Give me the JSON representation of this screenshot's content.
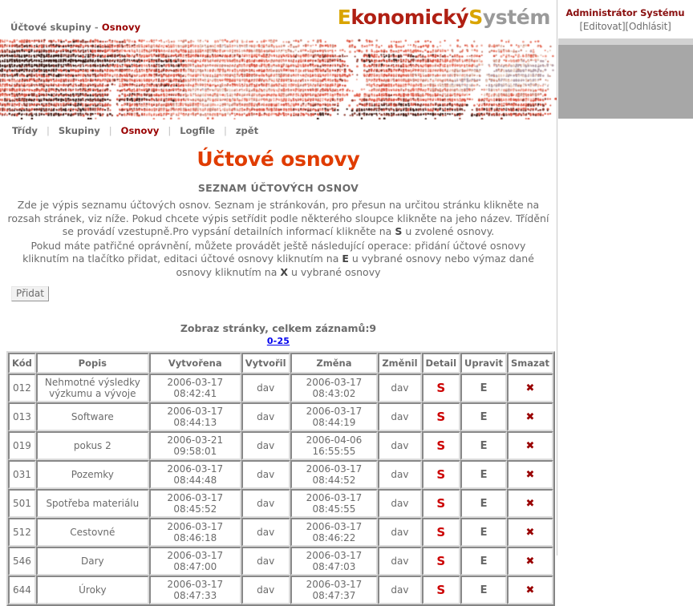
{
  "breadcrumb": {
    "parent": "Účtové skupiny",
    "separator": "-",
    "current": "Osnovy"
  },
  "logo": {
    "part1": "E",
    "part2": "konomický",
    "part3": "S",
    "part4": "ystém",
    "color_gold": "#d9a400",
    "color_red": "#b01f13",
    "color_gray": "#9a9a9a"
  },
  "admin": {
    "title": "Administrátor Systému",
    "edit_label": "[Editovat]",
    "logout_label": "[Odhlásit]"
  },
  "nav": {
    "items": [
      {
        "label": "Třídy",
        "active": false
      },
      {
        "label": "Skupiny",
        "active": false
      },
      {
        "label": "Osnovy",
        "active": true
      },
      {
        "label": "Logfile",
        "active": false
      },
      {
        "label": "zpět",
        "active": false
      }
    ],
    "separator": "|"
  },
  "page": {
    "title": "Účtové osnovy",
    "subtitle": "SEZNAM ÚČTOVÝCH OSNOV",
    "desc_line1": "Zde je výpis seznamu účtových osnov. Seznam je stránkován, pro přesun na určitou stránku klikněte na rozsah stránek, viz níže. Pokud chcete výpis setřídit podle některého sloupce klikněte na jeho název. Třídění se provádí vzestupně.Pro vypsání detailních informací klikněte na ",
    "desc_line1_bold": "S",
    "desc_line1_tail": " u zvolené osnovy.",
    "desc_line2_a": "Pokud máte patřičné oprávnění, můžete provádět ještě následující operace: přidání účtové osnovy kliknutím na tlačítko přidat, editaci účtové osnovy kliknutím na ",
    "desc_line2_bold1": "E",
    "desc_line2_b": " u vybrané osnovy nebo výmaz dané osnovy kliknutím na ",
    "desc_line2_bold2": "X",
    "desc_line2_c": " u vybrané osnovy",
    "add_button": "Přidat",
    "pager_label": "Zobraz stránky, celkem záznamů:9",
    "pager_range": "0-25"
  },
  "table": {
    "headers": [
      "Kód",
      "Popis",
      "Vytvořena",
      "Vytvořil",
      "Změna",
      "Změnil",
      "Detail",
      "Upravit",
      "Smazat"
    ],
    "action_detail": "S",
    "action_edit": "E",
    "action_delete": "✖",
    "rows": [
      {
        "kod": "012",
        "popis": "Nehmotné výsledky výzkumu a vývoje",
        "vytvorena": "2006-03-17\n08:42:41",
        "vytvoril": "dav",
        "zmena": "2006-03-17\n08:43:02",
        "zmenil": "dav"
      },
      {
        "kod": "013",
        "popis": "Software",
        "vytvorena": "2006-03-17\n08:44:13",
        "vytvoril": "dav",
        "zmena": "2006-03-17\n08:44:19",
        "zmenil": "dav"
      },
      {
        "kod": "019",
        "popis": "pokus 2",
        "vytvorena": "2006-03-21\n09:58:01",
        "vytvoril": "dav",
        "zmena": "2006-04-06\n16:55:55",
        "zmenil": "dav"
      },
      {
        "kod": "031",
        "popis": "Pozemky",
        "vytvorena": "2006-03-17\n08:44:48",
        "vytvoril": "dav",
        "zmena": "2006-03-17\n08:44:52",
        "zmenil": "dav"
      },
      {
        "kod": "501",
        "popis": "Spotřeba materiálu",
        "vytvorena": "2006-03-17\n08:45:52",
        "vytvoril": "dav",
        "zmena": "2006-03-17\n08:45:55",
        "zmenil": "dav"
      },
      {
        "kod": "512",
        "popis": "Cestovné",
        "vytvorena": "2006-03-17\n08:46:18",
        "vytvoril": "dav",
        "zmena": "2006-03-17\n08:46:22",
        "zmenil": "dav"
      },
      {
        "kod": "546",
        "popis": "Dary",
        "vytvorena": "2006-03-17\n08:47:00",
        "vytvoril": "dav",
        "zmena": "2006-03-17\n08:47:03",
        "zmenil": "dav"
      },
      {
        "kod": "644",
        "popis": "Úroky",
        "vytvorena": "2006-03-17\n08:47:33",
        "vytvoril": "dav",
        "zmena": "2006-03-17\n08:47:37",
        "zmenil": "dav"
      }
    ]
  },
  "banner": {
    "style": "halftone-dots",
    "palette": [
      "#e8705c",
      "#d94f3d",
      "#8c3a2e",
      "#3b1a14",
      "#f0a090",
      "#c98878",
      "#e5c8b8",
      "#b5a0a8"
    ]
  }
}
